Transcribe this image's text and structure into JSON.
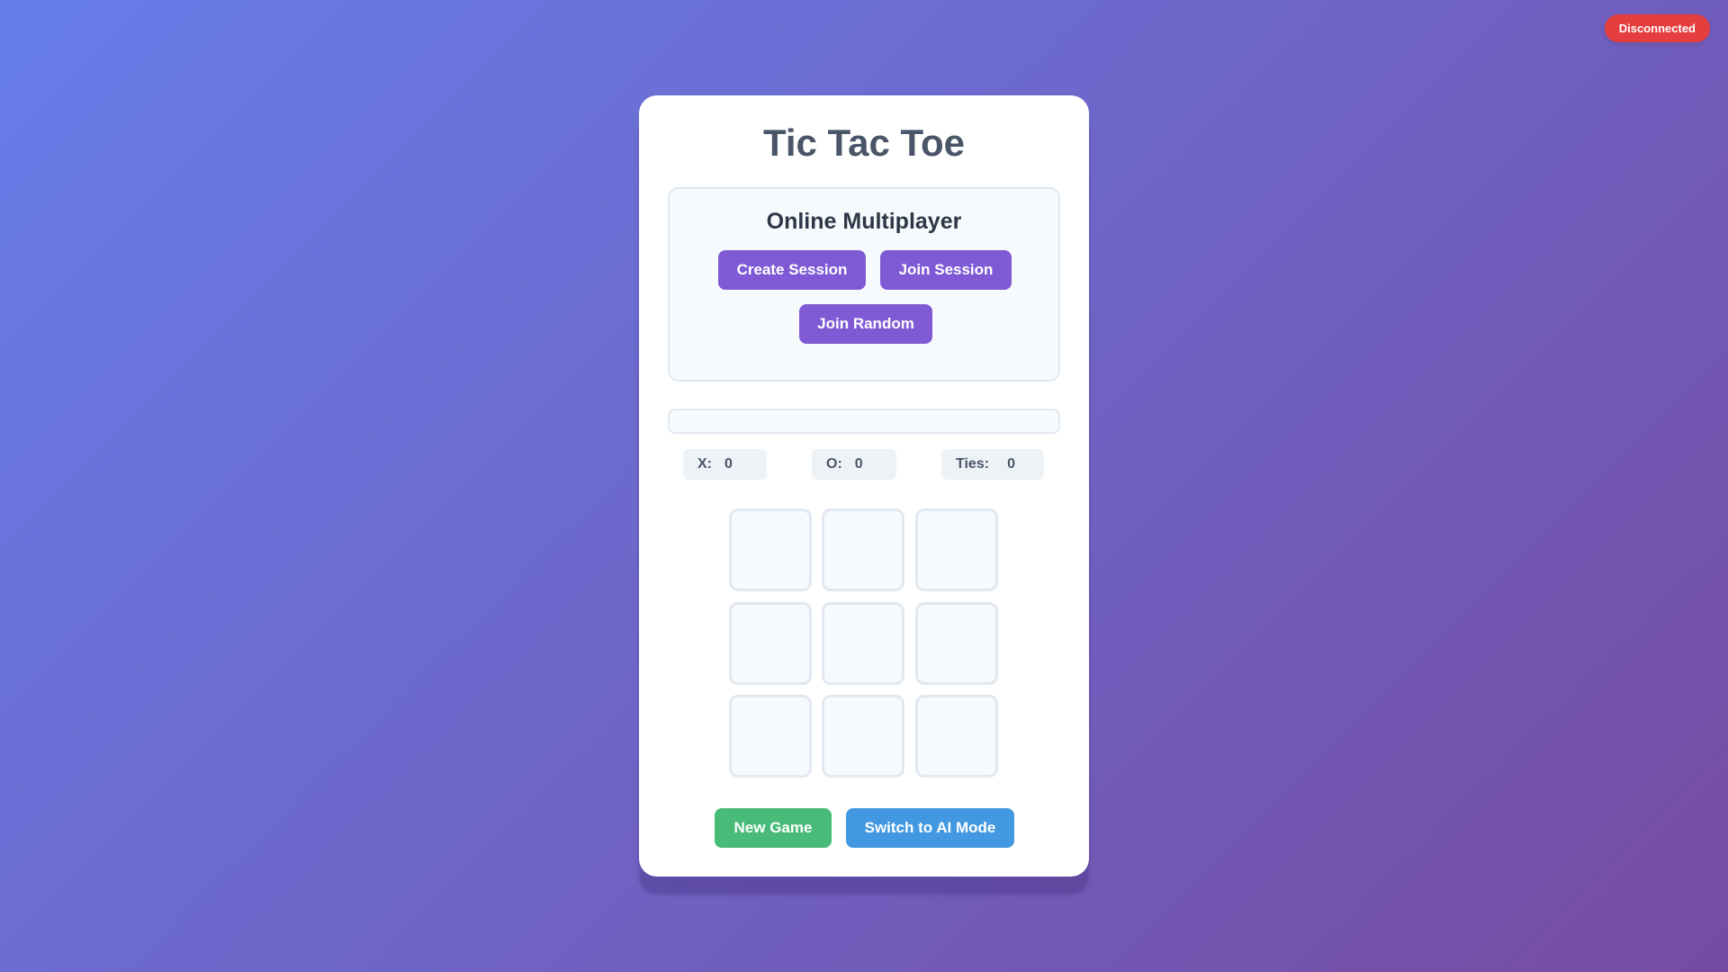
{
  "connection": {
    "status": "Disconnected",
    "status_color": "#e53e3e"
  },
  "game": {
    "title": "Tic Tac Toe",
    "status_message": ""
  },
  "multiplayer": {
    "title": "Online Multiplayer",
    "create_session_label": "Create Session",
    "join_session_label": "Join Session",
    "join_random_label": "Join Random"
  },
  "scores": {
    "x_label": "X:",
    "x_value": "0",
    "o_label": "O:",
    "o_value": "0",
    "ties_label": "Ties:",
    "ties_value": "0"
  },
  "board": {
    "cells": [
      "",
      "",
      "",
      "",
      "",
      "",
      "",
      "",
      ""
    ]
  },
  "controls": {
    "new_game_label": "New Game",
    "switch_mode_label": "Switch to AI Mode"
  },
  "colors": {
    "background_start": "#667eea",
    "background_end": "#764ba2",
    "accent_purple": "#805ad5",
    "accent_green": "#48bb78",
    "accent_blue": "#4299e1"
  }
}
